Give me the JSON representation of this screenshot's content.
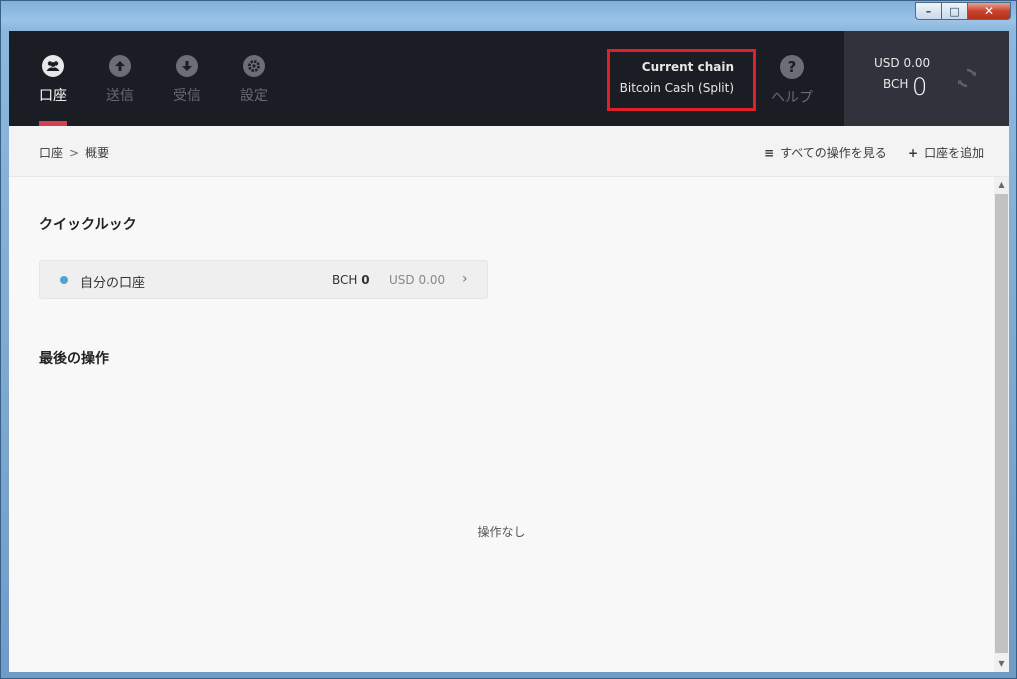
{
  "window": {
    "minimize_glyph": "–",
    "maximize_glyph": "□",
    "close_glyph": "✕"
  },
  "nav": {
    "items": [
      {
        "label": "口座",
        "icon": "accounts-icon",
        "active": true
      },
      {
        "label": "送信",
        "icon": "send-icon",
        "active": false
      },
      {
        "label": "受信",
        "icon": "receive-icon",
        "active": false
      },
      {
        "label": "設定",
        "icon": "settings-icon",
        "active": false
      }
    ]
  },
  "chain": {
    "title": "Current chain",
    "value": "Bitcoin Cash (Split)"
  },
  "help": {
    "label": "ヘルプ",
    "icon": "?"
  },
  "balance": {
    "usd": "USD 0.00",
    "bch_label": "BCH",
    "bch_value": "0"
  },
  "breadcrumb": {
    "root": "口座",
    "separator": ">",
    "current": "概要"
  },
  "actions": {
    "view_all": "すべての操作を見る",
    "add_account": "口座を追加"
  },
  "quick_look": {
    "title": "クイックルック",
    "accounts": [
      {
        "name": "自分の口座",
        "bch_unit": "BCH",
        "bch_value": "0",
        "usd": "USD 0.00"
      }
    ]
  },
  "last_operations": {
    "title": "最後の操作",
    "empty": "操作なし"
  },
  "colors": {
    "accent": "#d63f4e",
    "highlight_border": "#e02027",
    "account_dot": "#4ea5d1",
    "topbar": "#1b1d24"
  }
}
